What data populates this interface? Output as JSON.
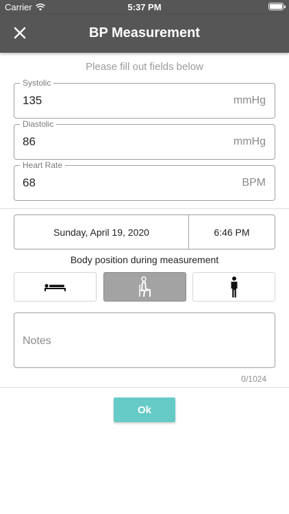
{
  "status_bar": {
    "carrier": "Carrier",
    "time": "5:37 PM"
  },
  "header": {
    "title": "BP Measurement",
    "close_icon": "close-icon"
  },
  "form": {
    "instructions": "Please fill out fields below",
    "systolic": {
      "label": "Systolic",
      "value": "135",
      "unit": "mmHg"
    },
    "diastolic": {
      "label": "Diastolic",
      "value": "86",
      "unit": "mmHg"
    },
    "heart_rate": {
      "label": "Heart Rate",
      "value": "68",
      "unit": "BPM"
    },
    "date": "Sunday, April 19, 2020",
    "time": "6:46 PM",
    "body_position_label": "Body position during measurement",
    "body_positions": [
      {
        "name": "lying",
        "icon": "lying-down-icon",
        "selected": false
      },
      {
        "name": "sitting",
        "icon": "sitting-icon",
        "selected": true
      },
      {
        "name": "standing",
        "icon": "standing-icon",
        "selected": false
      }
    ],
    "notes": {
      "placeholder": "Notes",
      "counter": "0/1024"
    }
  },
  "actions": {
    "ok_label": "Ok"
  },
  "colors": {
    "header": "#565656",
    "accent": "#66cbc7",
    "selected_position": "#a3a3a3"
  }
}
